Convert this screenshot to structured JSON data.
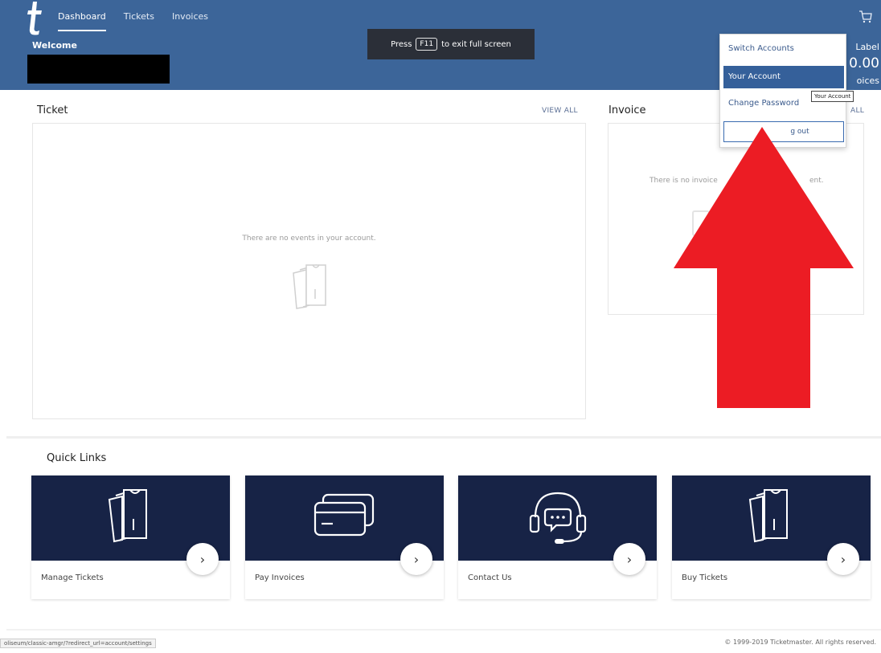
{
  "header": {
    "nav": [
      "Dashboard",
      "Tickets",
      "Invoices"
    ],
    "welcome": "Welcome",
    "fullscreen": {
      "before": "Press",
      "key": "F11",
      "after": "to exit full screen"
    },
    "right_label": "Label",
    "right_amount": "0.00",
    "right_invoices": "oices"
  },
  "ticket": {
    "title": "Ticket",
    "view_all": "VIEW ALL",
    "empty": "There are no events in your account."
  },
  "invoice": {
    "title": "Invoice",
    "view_all": "ALL",
    "empty_left": "There is no invoice",
    "empty_right": "ent."
  },
  "quick_links": {
    "title": "Quick Links",
    "items": [
      "Manage Tickets",
      "Pay Invoices",
      "Contact Us",
      "Buy Tickets"
    ]
  },
  "dropdown": {
    "switch": "Switch Accounts",
    "your_account": "Your Account",
    "change_password": "Change Password",
    "logout": "g out",
    "tooltip": "Your Account"
  },
  "footer": {
    "copyright": "© 1999-2019 Ticketmaster. All rights reserved.",
    "status_url": "oliseum/classic-amgr/?redirect_url=account/settings"
  },
  "colors": {
    "header_bg": "#3c6599",
    "quick_link_bg": "#172346",
    "arrow": "#ec1c24",
    "dropdown_active": "#35609a"
  }
}
